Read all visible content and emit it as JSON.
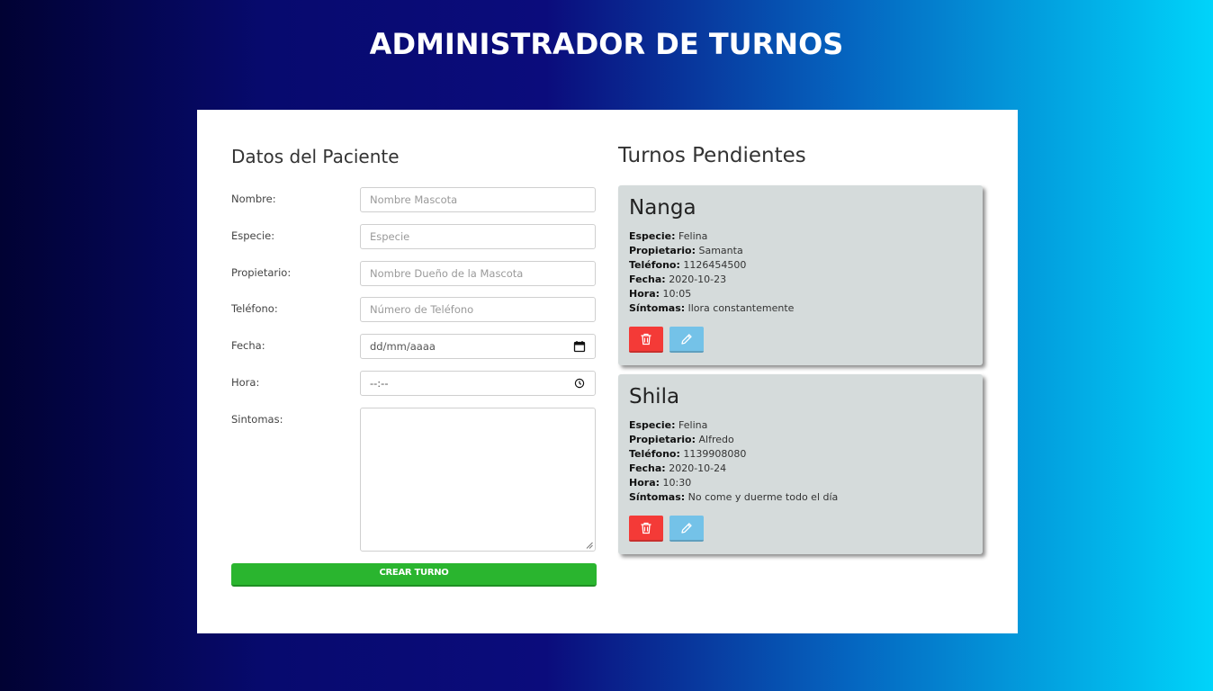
{
  "header": {
    "title": "ADMINISTRADOR DE TURNOS"
  },
  "form": {
    "title": "Datos del Paciente",
    "fields": [
      {
        "label": "Nombre:",
        "placeholder": "Nombre Mascota"
      },
      {
        "label": "Especie:",
        "placeholder": "Especie"
      },
      {
        "label": "Propietario:",
        "placeholder": "Nombre Dueño de la Mascota"
      },
      {
        "label": "Teléfono:",
        "placeholder": "Número de Teléfono"
      },
      {
        "label": "Fecha:",
        "placeholder": "dd/mm/aaaa",
        "icon": "calendar-icon"
      },
      {
        "label": "Hora:",
        "placeholder": "--:--",
        "icon": "clock-icon"
      },
      {
        "label": "Sintomas:",
        "placeholder": ""
      }
    ],
    "submit_label": "CREAR TURNO"
  },
  "appointments": {
    "title": "Turnos Pendientes",
    "labels": {
      "especie": "Especie:",
      "propietario": "Propietario:",
      "telefono": "Teléfono:",
      "fecha": "Fecha:",
      "hora": "Hora:",
      "sintomas": "Síntomas:"
    },
    "items": [
      {
        "name": "Nanga",
        "especie": "Felina",
        "propietario": "Samanta",
        "telefono": "1126454500",
        "fecha": "2020-10-23",
        "hora": "10:05",
        "sintomas": "llora constantemente"
      },
      {
        "name": "Shila",
        "especie": "Felina",
        "propietario": "Alfredo",
        "telefono": "1139908080",
        "fecha": "2020-10-24",
        "hora": "10:30",
        "sintomas": "No come y duerme todo el día"
      }
    ],
    "icons": {
      "delete": "trash-icon",
      "edit": "pencil-icon"
    }
  },
  "colors": {
    "create_button": "#2ab52f",
    "delete_button": "#f43a37",
    "edit_button": "#74c2e8",
    "card_background": "#d5dbdb"
  }
}
